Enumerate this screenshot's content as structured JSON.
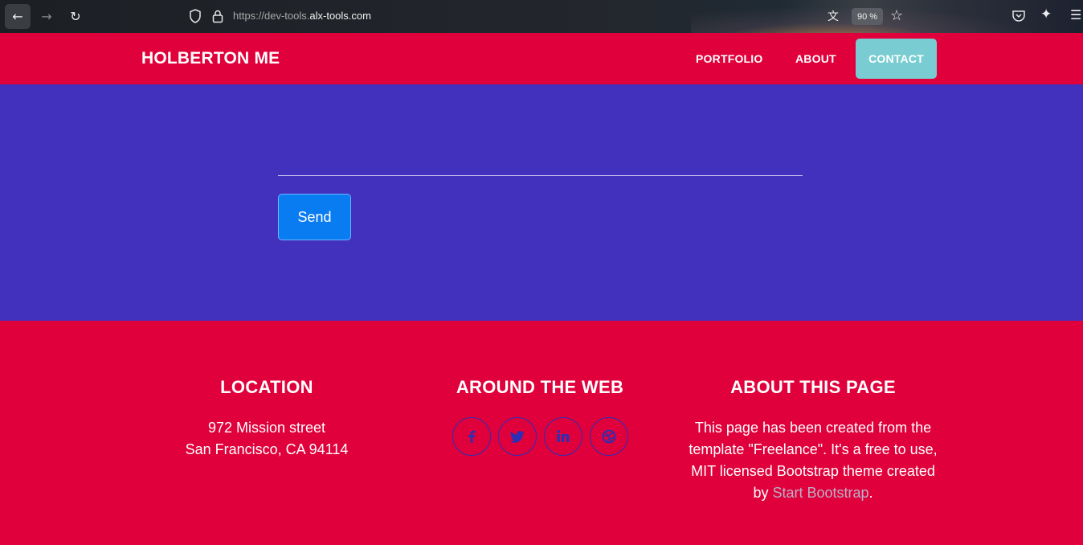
{
  "browser": {
    "url_prefix": "https://dev-tools.",
    "url_host": "alx-tools.com",
    "zoom": "90 %"
  },
  "navbar": {
    "brand": "HOLBERTON ME",
    "links": [
      {
        "label": "PORTFOLIO"
      },
      {
        "label": "ABOUT"
      },
      {
        "label": "CONTACT",
        "active": true
      }
    ]
  },
  "contact": {
    "message_value": "",
    "send_label": "Send"
  },
  "footer": {
    "location": {
      "title": "LOCATION",
      "line1": "972 Mission street",
      "line2": "San Francisco, CA 94114"
    },
    "web": {
      "title": "AROUND THE WEB",
      "icons": [
        "facebook-icon",
        "twitter-icon",
        "linkedin-icon",
        "dribbble-icon"
      ]
    },
    "about": {
      "title": "ABOUT THIS PAGE",
      "text_before": "This page has been created from the template \"Freelance\". It's a free to use, MIT licensed Bootstrap theme created by ",
      "link_text": "Start Bootstrap",
      "text_after": "."
    }
  },
  "colors": {
    "primary_red": "#e0003b",
    "section_purple": "#4131bd",
    "contact_active": "#79cdd2",
    "send_blue": "#0a7cf2",
    "social_blue": "#2a2fb5"
  }
}
